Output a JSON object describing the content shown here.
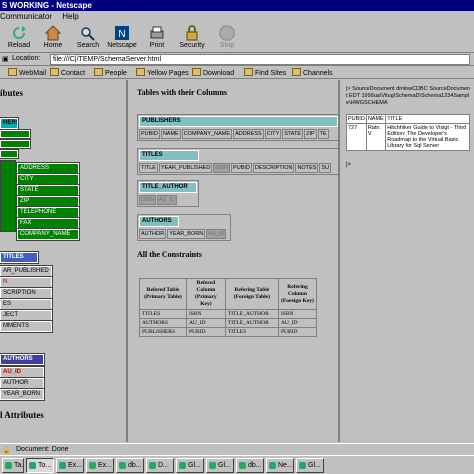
{
  "window": {
    "title": "S WORKING - Netscape"
  },
  "menu": [
    "Communicator",
    "Help"
  ],
  "toolbar": [
    {
      "label": "Reload",
      "icon": "reload-icon"
    },
    {
      "label": "Home",
      "icon": "home-icon"
    },
    {
      "label": "Search",
      "icon": "search-icon"
    },
    {
      "label": "Netscape",
      "icon": "netscape-icon"
    },
    {
      "label": "Print",
      "icon": "print-icon"
    },
    {
      "label": "Security",
      "icon": "security-icon"
    },
    {
      "label": "Stop",
      "icon": "stop-icon"
    }
  ],
  "location": {
    "label": "Location:",
    "url": "file:///C|/TEMP/SchemaServer.html"
  },
  "personal": [
    "WebMail",
    "Contact",
    "People",
    "Yellow Pages",
    "Download",
    "Find Sites",
    "Channels"
  ],
  "left": {
    "heading": "ibutes",
    "publishers_label": "HERS",
    "publisher_fields": [
      "ADDRESS",
      "CITY",
      "STATE",
      "ZIP",
      "TELEPHONE",
      "FAX",
      "COMPANY_NAME"
    ],
    "titles_label": "TITLES",
    "title_fields": [
      "AR_PUBLISHED",
      "N",
      "SCRIPTION",
      "ES",
      "JECT",
      "MMENTS"
    ],
    "authors_label": "AUTHORS",
    "author_fields": [
      "AU_ID",
      "AUTHOR",
      "YEAR_BORN"
    ],
    "footer": "l Attributes"
  },
  "mid": {
    "heading": "Tables with their Columns",
    "tables": [
      {
        "name": "PUBLISHERS",
        "cols": [
          "PUBID",
          "NAME",
          "COMPANY_NAME",
          "ADDRESS",
          "CITY",
          "STATE",
          "ZIP",
          "TE"
        ]
      },
      {
        "name": "TITLES",
        "cols": [
          "TITLE",
          "YEAR_PUBLISHED",
          "ISBN",
          "PUBID",
          "DESCRIPTION",
          "NOTES",
          "SU"
        ]
      },
      {
        "name": "TITLE_AUTHOR",
        "cols": [
          "ISBN",
          "AU_ID"
        ]
      },
      {
        "name": "AUTHORS",
        "cols": [
          "AUTHOR",
          "YEAR_BORN",
          "AU_ID"
        ]
      }
    ],
    "constraints_heading": "All the Constraints",
    "constraints_headers": [
      "Refered Table (Primary Table)",
      "Refered Column (Primary Key)",
      "Refering Table (Foreign Table)",
      "Refering Column (Foreign Key)"
    ],
    "constraints": [
      [
        "TITLES",
        "ISBN",
        "TITLE_AUTHOR",
        "ISBN"
      ],
      [
        "AUTHORS",
        "AU_ID",
        "TITLE_AUTHOR",
        "AU_ID"
      ],
      [
        "PUBLISHERS",
        "PUBID",
        "TITLES",
        "PUBID"
      ]
    ]
  },
  "right": {
    "text": "|> SourceDocument dmlowCDBC SourceDocument EDT 1999ua\\Vitug\\SchemaD\\Schema1234Sample\\HWGSCHEMA",
    "headers": [
      "PUBID",
      "NAME",
      "TITLE"
    ],
    "row": [
      "727",
      "Ratn. V",
      "Hitchhiker Guide to Visigt - Third Edition: The Developer's Roadmap to the Virtual Basic Library for Sql Server"
    ],
    "marker": "|>"
  },
  "status": {
    "text": "Document: Done"
  },
  "taskbar": [
    "Ta...",
    "To...",
    "Ex...",
    "Ex...",
    "db...",
    "D...",
    "Gl...",
    "Gl...",
    "db...",
    "Ne...",
    "Gl..."
  ]
}
